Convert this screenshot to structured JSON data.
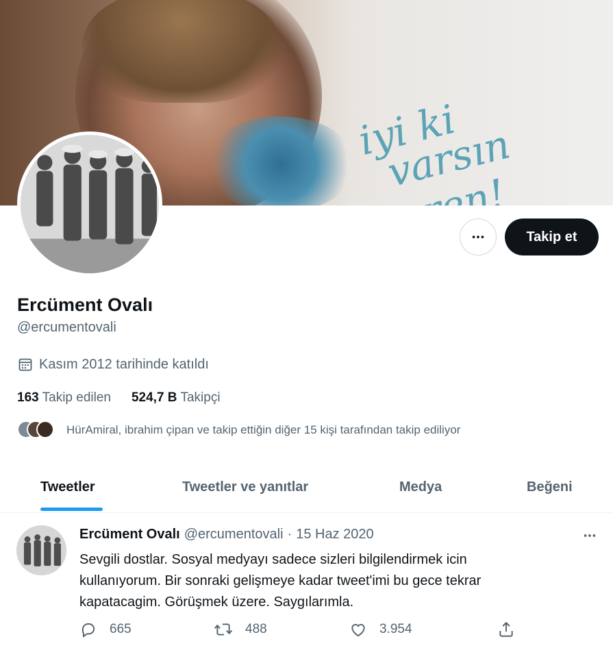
{
  "banner": {
    "script_line1": "iyi ki",
    "script_line2": "varsın eren!"
  },
  "profile": {
    "name": "Ercüment Ovalı",
    "handle": "@ercumentovali",
    "joined": "Kasım 2012 tarihinde katıldı",
    "following_count": "163",
    "following_label": "Takip edilen",
    "followers_count": "524,7 B",
    "followers_label": "Takipçi",
    "followed_by": "HürAmiral, ibrahim çipan ve takip ettiğin diğer 15 kişi tarafından takip ediliyor"
  },
  "actions": {
    "follow_label": "Takip et"
  },
  "tabs": [
    {
      "label": "Tweetler",
      "active": true
    },
    {
      "label": "Tweetler ve yanıtlar",
      "active": false
    },
    {
      "label": "Medya",
      "active": false
    },
    {
      "label": "Beğeni",
      "active": false
    }
  ],
  "tweet": {
    "name": "Ercüment Ovalı",
    "handle": "@ercumentovali",
    "separator": "·",
    "date": "15 Haz 2020",
    "text": "Sevgili dostlar. Sosyal medyayı sadece sizleri bilgilendirmek icin\nkullanıyorum.  Bir sonraki gelişmeye kadar  tweet'imi bu gece tekrar\nkapatacagim.  Görüşmek üzere. Saygılarımla.",
    "replies": "665",
    "retweets": "488",
    "likes": "3.954"
  },
  "colors": {
    "accent": "#1d9bf0",
    "text": "#0f1419",
    "muted": "#536471",
    "border": "#cfd9de"
  },
  "icons": [
    "more-icon",
    "calendar-icon",
    "reply-icon",
    "retweet-icon",
    "like-icon",
    "share-icon"
  ]
}
